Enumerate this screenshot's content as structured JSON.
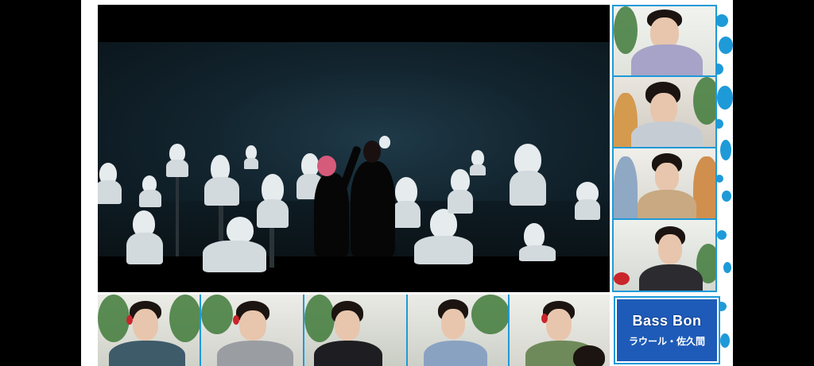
{
  "title_card": {
    "title": "Bass Bon",
    "subtitle": "ラウール・佐久間"
  },
  "colors": {
    "accent_blue": "#1e9ad8",
    "card_blue": "#1e5bb8",
    "frame_white": "#ffffff"
  },
  "icons": [
    "polka-dot-decoration"
  ]
}
